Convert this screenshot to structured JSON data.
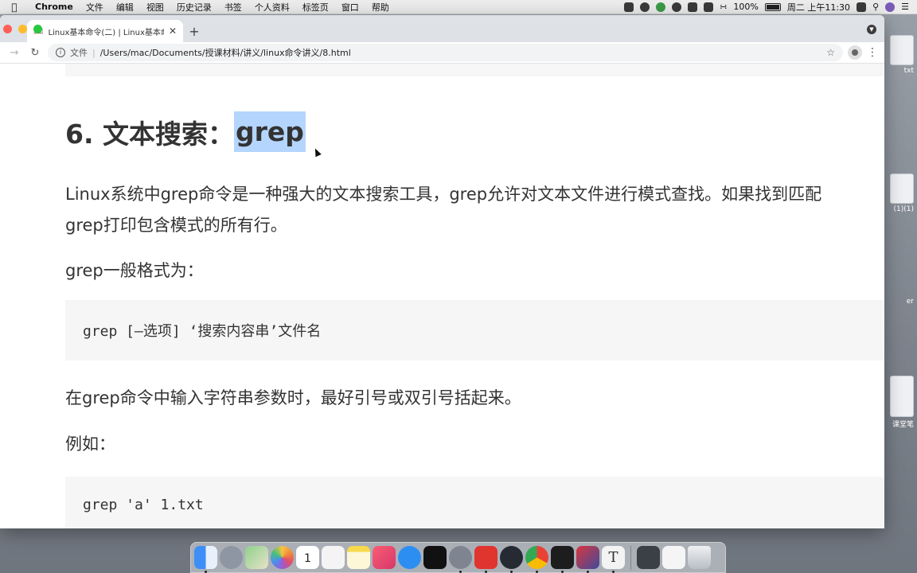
{
  "menubar": {
    "app_name": "Chrome",
    "items": [
      "文件",
      "编辑",
      "视图",
      "历史记录",
      "书签",
      "个人资料",
      "标签页",
      "窗口",
      "帮助"
    ],
    "battery": "100%",
    "clock": "周二 上午11:30"
  },
  "browser": {
    "tab_title": "Linux基本命令(二) | Linux基本命",
    "omnibox_scheme": "文件",
    "url": "/Users/mac/Documents/授课材料/讲义/linux命令讲义/8.html"
  },
  "page": {
    "heading_prefix": "6. 文本搜索：",
    "heading_selected": "grep",
    "para1_line1": "Linux系统中grep命令是一种强大的文本搜索工具，grep允许对文本文件进行模式查找。如果找到匹配",
    "para1_line2": "grep打印包含模式的所有行。",
    "para2": "grep一般格式为：",
    "code1": "grep [—选项] ‘搜索内容串’文件名",
    "para3": "在grep命令中输入字符串参数时，最好引号或双引号括起来。",
    "para4": "例如：",
    "code2": "grep 'a' 1.txt"
  },
  "desktop": {
    "icon1_label": "txt",
    "icon2_label": "(1)(1)",
    "icon3_label": "er",
    "icon4_label": "课堂笔"
  },
  "dock": {
    "icons": [
      "finder-icon",
      "launchpad-icon",
      "maps-icon",
      "photos-icon",
      "calendar-icon",
      "reminders-icon",
      "notes-icon",
      "music-icon",
      "safari-icon",
      "tv-icon",
      "settings-icon",
      "xmind-icon",
      "obs-icon",
      "chrome-icon",
      "terminal-icon",
      "parallels-icon",
      "typora-icon",
      "screenshot-icon",
      "preview-icon",
      "trash-icon"
    ],
    "calendar_day": "1"
  },
  "colors": {
    "selection": "#b4d5fe",
    "code_bg": "#f6f6f6",
    "text": "#333333"
  }
}
